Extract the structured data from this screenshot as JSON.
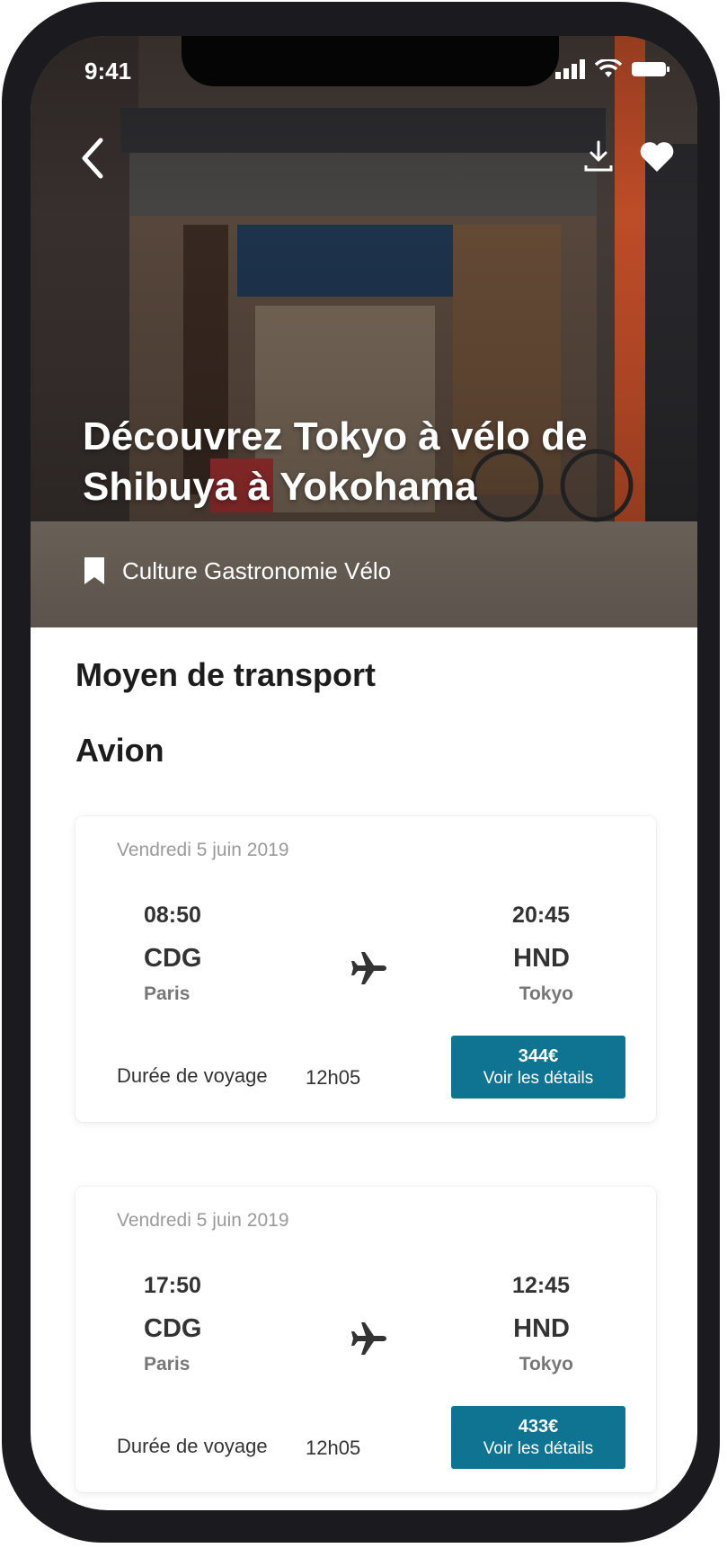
{
  "status": {
    "time": "9:41"
  },
  "hero": {
    "title": "Découvrez Tokyo à vélo de Shibuya à Yokohama",
    "tags": "Culture Gastronomie Vélo"
  },
  "section": {
    "title": "Moyen de transport",
    "subtitle": "Avion"
  },
  "flights": [
    {
      "date": "Vendredi 5 juin 2019",
      "dep_time": "08:50",
      "dep_code": "CDG",
      "dep_city": "Paris",
      "arr_time": "20:45",
      "arr_code": "HND",
      "arr_city": "Tokyo",
      "duration_label": "Durée de voyage",
      "duration": "12h05",
      "price": "344€",
      "details_label": "Voir les détails"
    },
    {
      "date": "Vendredi 5 juin 2019",
      "dep_time": "17:50",
      "dep_code": "CDG",
      "dep_city": "Paris",
      "arr_time": "12:45",
      "arr_code": "HND",
      "arr_city": "Tokyo",
      "duration_label": "Durée de voyage",
      "duration": "12h05",
      "price": "433€",
      "details_label": "Voir les détails"
    }
  ],
  "colors": {
    "accent": "#0f7491",
    "frame": "#1b1b1f"
  },
  "icons": [
    "back-chevron-icon",
    "download-icon",
    "heart-icon",
    "bookmark-icon",
    "plane-icon",
    "signal-icon",
    "wifi-icon",
    "battery-icon"
  ]
}
